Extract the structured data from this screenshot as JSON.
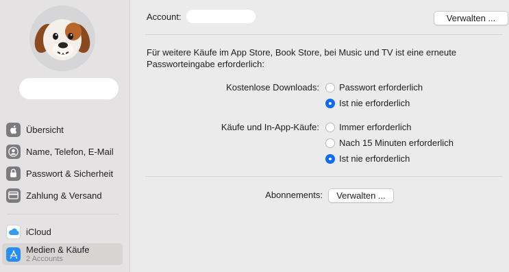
{
  "sidebar": {
    "items": [
      {
        "label": "Übersicht",
        "icon": "apple-icon"
      },
      {
        "label": "Name, Telefon, E-Mail",
        "icon": "person-icon"
      },
      {
        "label": "Passwort & Sicherheit",
        "icon": "lock-icon"
      },
      {
        "label": "Zahlung & Versand",
        "icon": "credit-card-icon"
      },
      {
        "label": "iCloud",
        "icon": "cloud-icon"
      },
      {
        "label": "Medien & Käufe",
        "sub": "2 Accounts",
        "icon": "app-store-icon",
        "selected": true
      }
    ]
  },
  "main": {
    "account_label": "Account:",
    "manage_button": "Verwalten ...",
    "info_text": "Für weitere Käufe im App Store, Book Store, bei Music und TV ist eine erneute Passworteingabe erforderlich:",
    "free_downloads": {
      "label": "Kostenlose Downloads:",
      "options": [
        "Passwort erforderlich",
        "Ist nie erforderlich"
      ],
      "selected": 1
    },
    "purchases": {
      "label": "Käufe und In-App-Käufe:",
      "options": [
        "Immer erforderlich",
        "Nach 15 Minuten erforderlich",
        "Ist nie erforderlich"
      ],
      "selected": 2
    },
    "subscriptions": {
      "label": "Abonnements:",
      "button": "Verwalten ..."
    }
  },
  "colors": {
    "accent": "#0a6cf0",
    "sidebar_bg": "#e4e2e2",
    "main_bg": "#ecebeb"
  }
}
